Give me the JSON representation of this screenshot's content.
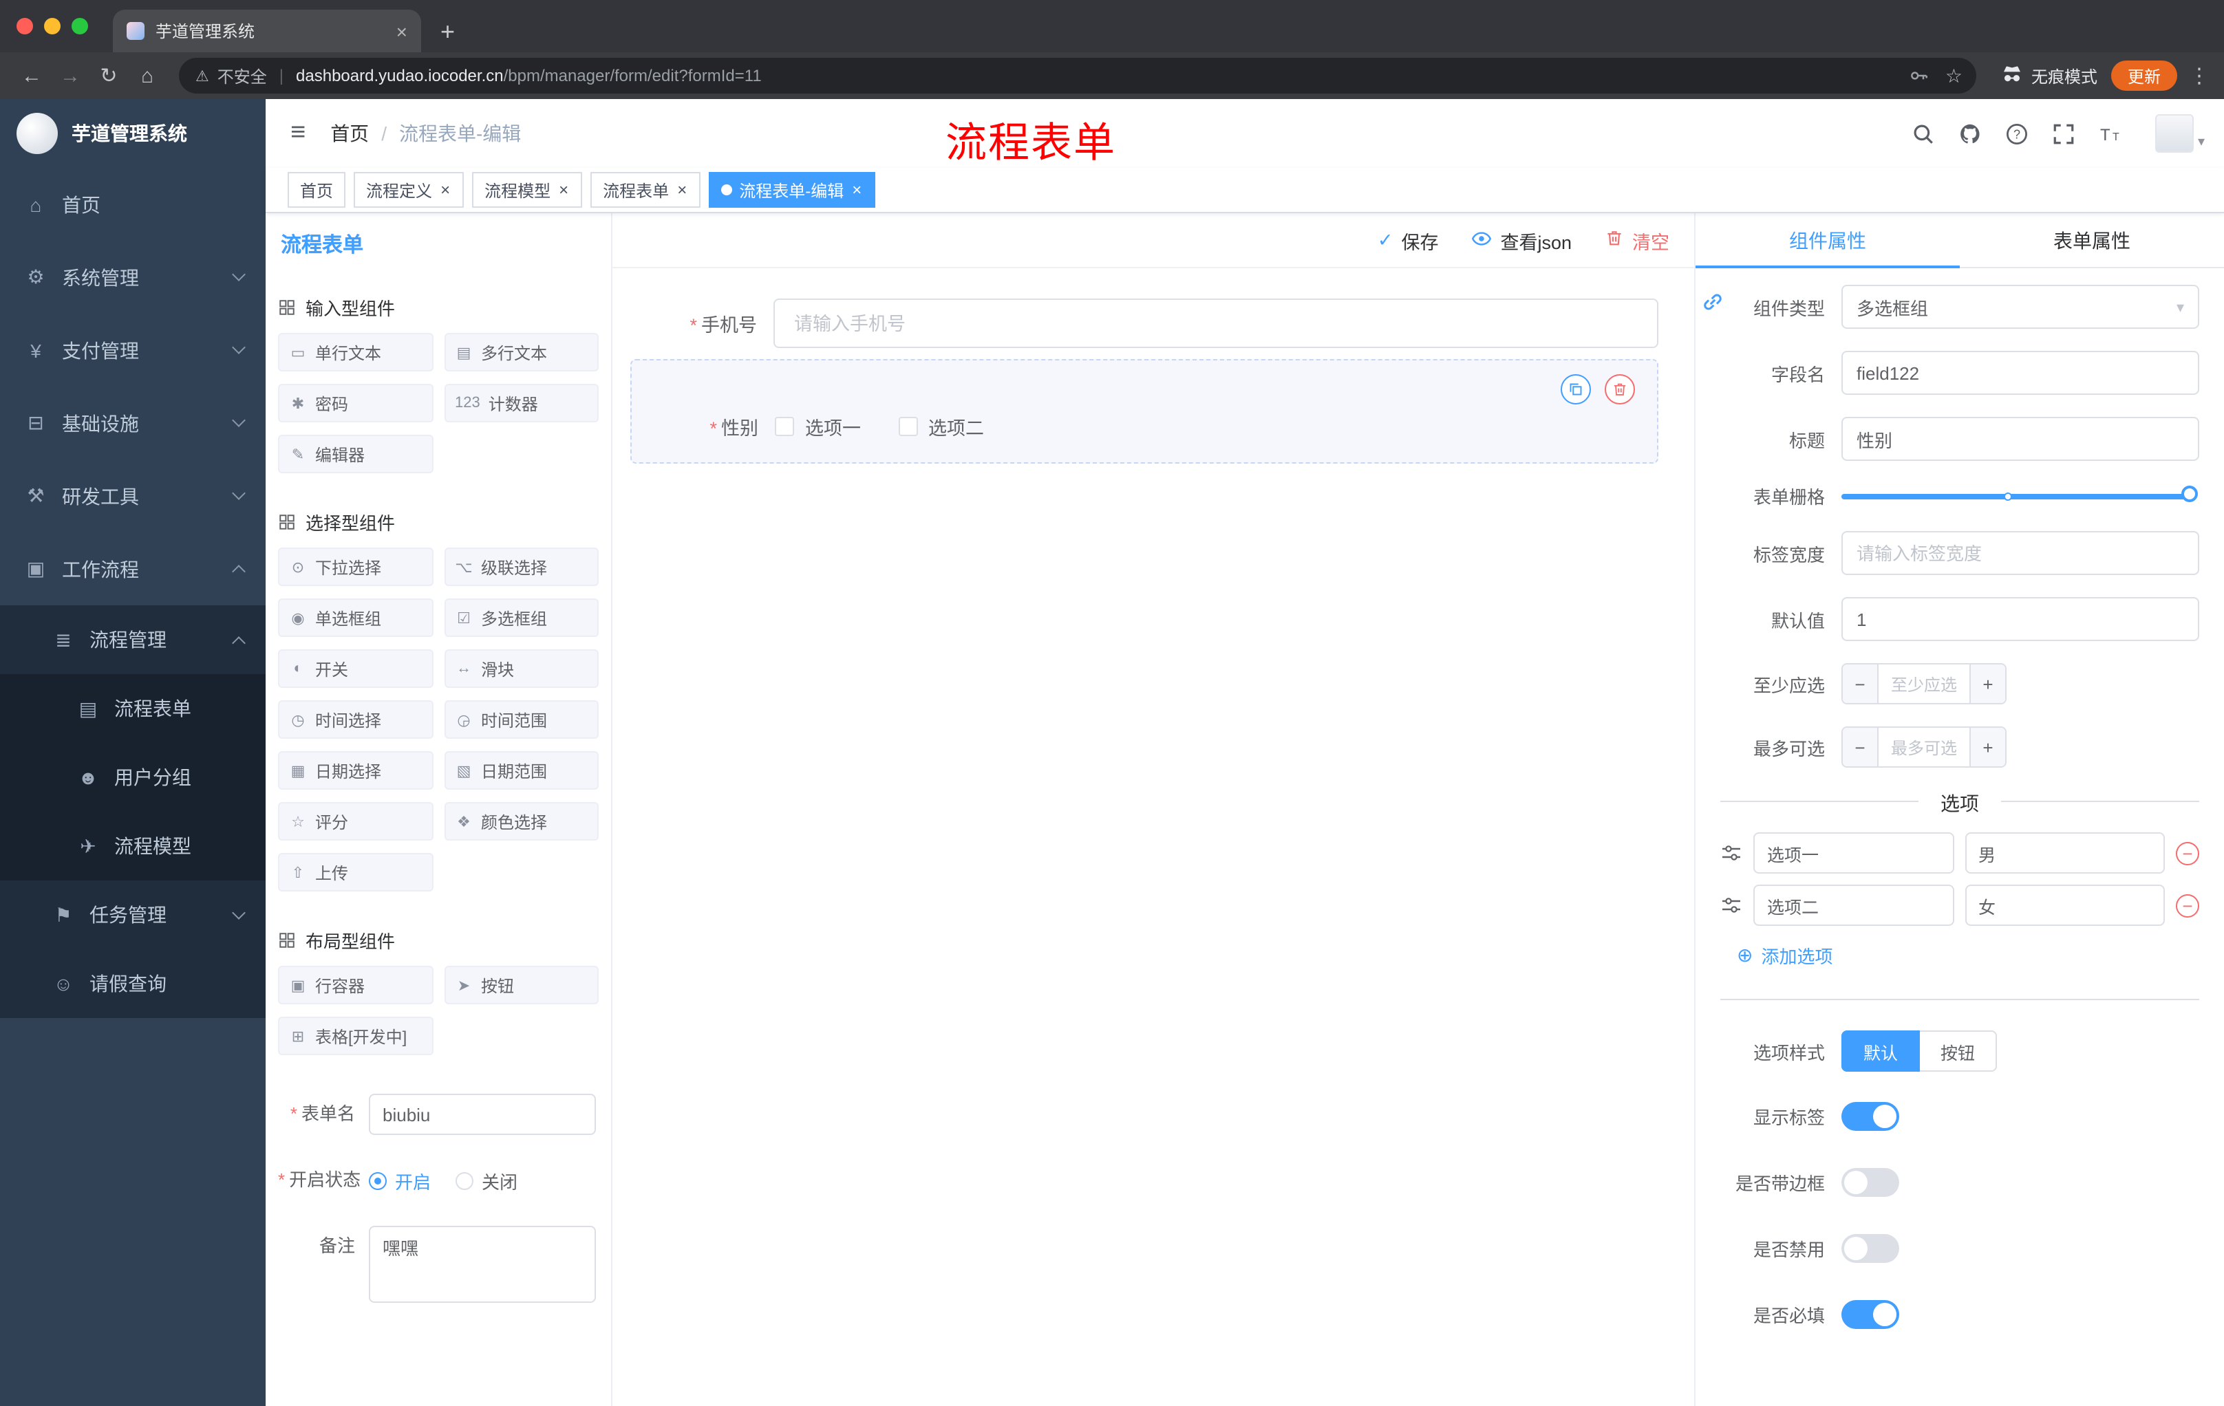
{
  "colors": {
    "accent": "#409eff",
    "danger": "#f56c6c",
    "sidebar_bg": "#304156",
    "submenu_bg": "#1f2d3d",
    "active_tag_bg": "#409eff",
    "update_chip": "#e9661f",
    "annotation": "#fe0000"
  },
  "browser": {
    "tab_title": "芋道管理系统",
    "security_label": "不安全",
    "url_domain": "dashboard.yudao.iocoder.cn",
    "url_path": "/bpm/manager/form/edit?formId=11",
    "incognito_label": "无痕模式",
    "update_label": "更新"
  },
  "sidebar": {
    "logo_title": "芋道管理系统",
    "menu": [
      {
        "key": "home",
        "label": "首页",
        "icon": "home-icon",
        "level": 0
      },
      {
        "key": "system-management",
        "label": "系统管理",
        "icon": "gear-icon",
        "level": 0,
        "chevron": "down"
      },
      {
        "key": "payment-management",
        "label": "支付管理",
        "icon": "payment-icon",
        "level": 0,
        "chevron": "down"
      },
      {
        "key": "infrastructure",
        "label": "基础设施",
        "icon": "infrastructure-icon",
        "level": 0,
        "chevron": "down"
      },
      {
        "key": "dev-tools",
        "label": "研发工具",
        "icon": "tools-icon",
        "level": 0,
        "chevron": "down"
      },
      {
        "key": "workflow",
        "label": "工作流程",
        "icon": "workflow-icon",
        "level": 0,
        "chevron": "up"
      },
      {
        "key": "process-management",
        "label": "流程管理",
        "icon": "process-management-icon",
        "level": 1,
        "chevron": "up"
      },
      {
        "key": "process-form",
        "label": "流程表单",
        "icon": "process-form-icon",
        "level": 2
      },
      {
        "key": "user-group",
        "label": "用户分组",
        "icon": "user-group-icon",
        "level": 2
      },
      {
        "key": "process-model",
        "label": "流程模型",
        "icon": "process-model-icon",
        "level": 2
      },
      {
        "key": "task-management",
        "label": "任务管理",
        "icon": "task-management-icon",
        "level": 1,
        "chevron": "down"
      },
      {
        "key": "leave-query",
        "label": "请假查询",
        "icon": "leave-query-icon",
        "level": 1
      }
    ]
  },
  "header": {
    "breadcrumb_root": "首页",
    "breadcrumb_current": "流程表单-编辑",
    "annotation": "流程表单"
  },
  "tags_view": [
    {
      "key": "home",
      "label": "首页",
      "closable": false,
      "active": false
    },
    {
      "key": "process-definition",
      "label": "流程定义",
      "closable": true,
      "active": false
    },
    {
      "key": "process-model",
      "label": "流程模型",
      "closable": true,
      "active": false
    },
    {
      "key": "process-form",
      "label": "流程表单",
      "closable": true,
      "active": false
    },
    {
      "key": "process-form-edit",
      "label": "流程表单-编辑",
      "closable": true,
      "active": true
    }
  ],
  "designer": {
    "panel_title": "流程表单",
    "actions": {
      "save": "保存",
      "view_json": "查看json",
      "clear": "清空"
    },
    "component_groups": [
      {
        "title": "输入型组件",
        "items": [
          {
            "label": "单行文本",
            "icon": "single-line-text-icon"
          },
          {
            "label": "多行文本",
            "icon": "multi-line-text-icon"
          },
          {
            "label": "密码",
            "icon": "password-icon"
          },
          {
            "label": "计数器",
            "icon": "counter-icon"
          },
          {
            "label": "编辑器",
            "icon": "editor-icon"
          }
        ]
      },
      {
        "title": "选择型组件",
        "items": [
          {
            "label": "下拉选择",
            "icon": "select-icon"
          },
          {
            "label": "级联选择",
            "icon": "cascader-icon"
          },
          {
            "label": "单选框组",
            "icon": "radio-group-icon"
          },
          {
            "label": "多选框组",
            "icon": "checkbox-group-icon"
          },
          {
            "label": "开关",
            "icon": "switch-icon"
          },
          {
            "label": "滑块",
            "icon": "slider-icon"
          },
          {
            "label": "时间选择",
            "icon": "time-picker-icon"
          },
          {
            "label": "时间范围",
            "icon": "time-range-icon"
          },
          {
            "label": "日期选择",
            "icon": "date-picker-icon"
          },
          {
            "label": "日期范围",
            "icon": "date-range-icon"
          },
          {
            "label": "评分",
            "icon": "rate-icon"
          },
          {
            "label": "颜色选择",
            "icon": "color-picker-icon"
          },
          {
            "label": "上传",
            "icon": "upload-icon"
          }
        ]
      },
      {
        "title": "布局型组件",
        "items": [
          {
            "label": "行容器",
            "icon": "row-container-icon"
          },
          {
            "label": "按钮",
            "icon": "button-icon"
          },
          {
            "label": "表格[开发中]",
            "icon": "table-icon"
          }
        ]
      }
    ],
    "meta_form": {
      "name_label": "表单名",
      "name_value": "biubiu",
      "status_label": "开启状态",
      "status_options": [
        "开启",
        "关闭"
      ],
      "status_selected": "开启",
      "remark_label": "备注",
      "remark_value": "嘿嘿"
    },
    "canvas": {
      "phone_label": "手机号",
      "phone_placeholder": "请输入手机号",
      "gender_label": "性别",
      "gender_options": [
        "选项一",
        "选项二"
      ]
    }
  },
  "properties": {
    "tab_component": "组件属性",
    "tab_form": "表单属性",
    "component_type_label": "组件类型",
    "component_type_value": "多选框组",
    "field_name_label": "字段名",
    "field_name_value": "field122",
    "title_label": "标题",
    "title_value": "性别",
    "grid_label": "表单栅格",
    "label_width_label": "标签宽度",
    "label_width_placeholder": "请输入标签宽度",
    "default_label": "默认值",
    "default_value": "1",
    "min_label": "至少应选",
    "min_placeholder": "至少应选",
    "max_label": "最多可选",
    "max_placeholder": "最多可选",
    "options_divider": "选项",
    "options": [
      {
        "name": "选项一",
        "value": "男"
      },
      {
        "name": "选项二",
        "value": "女"
      }
    ],
    "add_option_label": "添加选项",
    "option_style_label": "选项样式",
    "option_style_choices": [
      "默认",
      "按钮"
    ],
    "option_style_selected": "默认",
    "switches": [
      {
        "key": "show-label",
        "label": "显示标签",
        "on": true
      },
      {
        "key": "bordered",
        "label": "是否带边框",
        "on": false
      },
      {
        "key": "disabled",
        "label": "是否禁用",
        "on": false
      },
      {
        "key": "required",
        "label": "是否必填",
        "on": true
      }
    ]
  }
}
